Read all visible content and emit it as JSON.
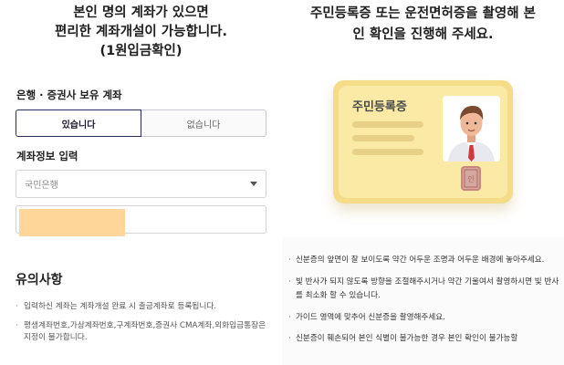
{
  "left": {
    "title_lines": [
      "본인 명의 계좌가 있으면",
      "편리한 계좌개설이 가능합니다.",
      "(1원입금확인)"
    ],
    "account_owned_label": "은행 · 증권사 보유 계좌",
    "segment": {
      "yes": "있습니다",
      "no": "없습니다",
      "selected": "yes"
    },
    "account_info_label": "계좌정보 입력",
    "bank_select": {
      "value": "국민은행"
    },
    "notice": {
      "title": "유의사항",
      "items": [
        "입력하신 계좌는 계좌개설 완료 시 출금계좌로 등록됩니다.",
        "평생계좌번호,가상계좌번호,구계좌번호,증권사 CMA계좌,외화입금통장은 지정이 불가합니다."
      ]
    }
  },
  "right": {
    "title_lines": [
      "주민등록증 또는 운전면허증을 촬영해 본",
      "인 확인을 진행해 주세요."
    ],
    "card": {
      "label": "주민등록증",
      "stamp_text": "인"
    },
    "guides": [
      "신분증의 앞면이 잘 보이도록 약간 어두운 조명과 어두운 배경에 놓아주세요.",
      "빛 반사가 되지 않도록 방향을 조절해주시거나 약간 기울여서 촬영하시면 빛 반사를 최소화 할 수 있습니다.",
      "가이드 영역에 맞추어 신분증을 촬영해주세요.",
      "신분증이 훼손되어 본인 식별이 불가능한 경우 본인 확인이 불가능할"
    ]
  },
  "colors": {
    "accent_navy": "#2a2f5e",
    "card_yellow": "#f5dc86",
    "mask_orange": "#ffd69a"
  }
}
